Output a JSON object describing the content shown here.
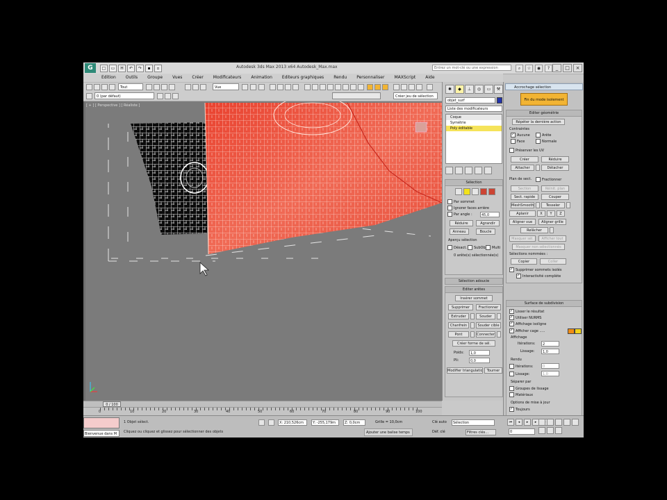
{
  "window": {
    "title": "Autodesk 3ds Max 2013 x64    Autodesk_Max.max",
    "search_placeholder": "Entrez un mot-clé ou une expression",
    "logo": "G"
  },
  "menu": [
    "Edition",
    "Outils",
    "Groupe",
    "Vues",
    "Créer",
    "Modificateurs",
    "Animation",
    "Editeurs graphiques",
    "Rendu",
    "Personnaliser",
    "MAXScript",
    "Aide"
  ],
  "toolbar": {
    "selection_filter": "Tout",
    "view_ref": "Vue",
    "named_sets": "Créer jeu de sélection",
    "layer": "0 (par défaut)"
  },
  "viewport": {
    "label": "[ + ] [ Perspective ] [ Réaliste ]"
  },
  "timeline": {
    "frame": "0 / 100",
    "ticks": [
      "0",
      "10",
      "20",
      "30",
      "40",
      "50",
      "60",
      "70",
      "80",
      "90",
      "100"
    ]
  },
  "status": {
    "selection_info": "1 Objet sélect.",
    "prompt": "Cliquez ou cliquez et glissez pour sélectionner des objets",
    "maxscript": "Bienvenue dans M",
    "x": "X: 210,526cm",
    "y": "Y: -255,179m",
    "z": "Z: 0,0cm",
    "grid": "Grille = 10,0cm",
    "add_time_tag": "Ajouter une balise temps",
    "auto_key": "Clé auto",
    "selected": "Sélection",
    "set_key": "Déf. clé",
    "key_filters": "Filtres clés...",
    "frame": "0"
  },
  "command_panel": {
    "object_name": "objet_surf",
    "modifier_list": "Liste des modificateurs",
    "stack": [
      {
        "label": "Coque",
        "selected": false,
        "sub": true
      },
      {
        "label": "Symétrie",
        "selected": false,
        "sub": false
      },
      {
        "label": "Poly éditable",
        "selected": true,
        "sub": false
      }
    ],
    "selection": {
      "title": "Sélection",
      "by_vertex": "Par sommet",
      "ignore_backfacing": "Ignorer faces arrière",
      "by_angle": "Par angle :",
      "angle_value": "45,0",
      "shrink": "Réduire",
      "grow": "Agrandir",
      "ring": "Anneau",
      "loop": "Boucle",
      "preview_title": "Aperçu sélection",
      "off": "Désact.",
      "sub_obj": "SubObj",
      "multi": "Multi",
      "count": "0 arête(s) sélectionnée(s)"
    },
    "soft_selection": "Sélection adoucie",
    "edit_edges": {
      "title": "Editer arêtes",
      "insert_vertex": "Insérer sommet",
      "remove": "Supprimer",
      "split": "Fractionner",
      "extrude": "Extruder",
      "weld": "Souder",
      "chamfer": "Chanfrein",
      "target_weld": "Souder cible",
      "bridge": "Pont",
      "connect": "Connecter",
      "create_shape": "Créer forme de sél.",
      "weight": "Poids:",
      "weight_value": "1,0",
      "crease": "Pli:",
      "crease_value": "0,0",
      "edit_tri": "Modifier triangulation",
      "turn": "Tourner"
    }
  },
  "right_panel": {
    "title": "Accrochage sélection",
    "exit_button": "Fin du mode isolement",
    "edit_geometry": {
      "title": "Editer géométrie",
      "repeat_last": "Répéter la dernière action",
      "constraints": "Contraintes",
      "none": "Aucune",
      "edge": "Arête",
      "face": "Face",
      "normal": "Normale",
      "preserve_uvs": "Préserver les UV",
      "create": "Créer",
      "collapse": "Réduire",
      "attach": "Attacher",
      "detach": "Détacher",
      "slice_plane": "Plan de sect.",
      "split": "Fractionner",
      "slice": "Section",
      "reset_plane": "Réinit. plan",
      "quickslice": "Sect. rapide",
      "cut": "Couper",
      "meshsmooth": "MeshSmooth",
      "tessellate": "Tesseler",
      "make_planar": "Aplanir",
      "view_align": "Aligner vue",
      "grid_align": "Aligner grille",
      "relax": "Relâcher",
      "hide_selected": "Masquer sél.",
      "unhide_all": "Afficher tout",
      "hide_unselected": "Masquer non sélectionnés",
      "named_selections": "Sélections nommées :",
      "copy": "Copier",
      "paste": "Coller",
      "delete_isolated": "Supprimer sommets isolés",
      "full_interactivity": "Interactivité complète",
      "x_label": "X",
      "y_label": "Y",
      "z_label": "Z"
    },
    "subdivision": {
      "title": "Surface de subdivision",
      "smooth_result": "Lisser le résultat",
      "use_nurms": "Utiliser NURMS",
      "isoline_display": "Affichage isoligne",
      "show_cage": "Afficher cage .....",
      "display": "Affichage",
      "iterations": "Itérations:",
      "iterations_value": "2",
      "smoothness": "Lissage:",
      "smoothness_value": "1,0",
      "render": "Rendu",
      "r_iterations": "Itérations:",
      "r_iterations_value": "0",
      "r_smoothness": "Lissage:",
      "r_smoothness_value": "1,0",
      "separate_by": "Séparer par",
      "smoothing_groups": "Groupes de lissage",
      "materials": "Matériaux",
      "update_options": "Options de mise à jour",
      "always": "Toujours"
    },
    "cage_color_1": "#f08c14",
    "cage_color_2": "#f2d21a"
  }
}
